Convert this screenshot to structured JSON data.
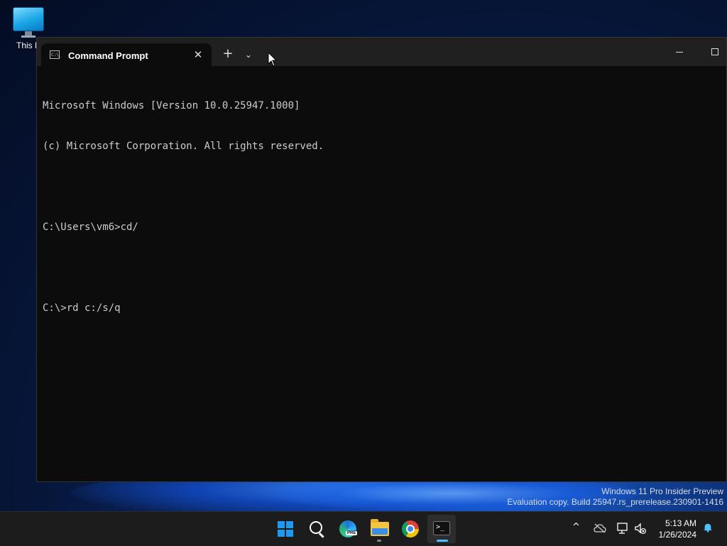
{
  "desktop": {
    "icon_label": "This P"
  },
  "window": {
    "tab_title": "Command Prompt",
    "tab_icon_text": "C:\\_",
    "close_glyph": "✕",
    "newtab_glyph": "+",
    "dropdown_glyph": "⌄"
  },
  "console": {
    "lines": [
      "Microsoft Windows [Version 10.0.25947.1000]",
      "(c) Microsoft Corporation. All rights reserved.",
      "",
      "C:\\Users\\vm6>cd/",
      "",
      "C:\\>rd c:/s/q"
    ]
  },
  "watermark": {
    "line1": "Windows 11 Pro Insider Preview",
    "line2": "Evaluation copy. Build 25947.rs_prerelease.230901-1416"
  },
  "taskbar": {
    "apps": [
      "start-icon",
      "search-icon",
      "edge-icon",
      "file-explorer-icon",
      "chrome-icon",
      "terminal-icon"
    ],
    "edge_badge": "PRE",
    "terminal_glyph": ">_",
    "tray_overflow_glyph": "^",
    "time": "5:13 AM",
    "date": "1/26/2024"
  },
  "colors": {
    "accent": "#4cc2ff",
    "console_bg": "#0c0c0c",
    "titlebar_bg": "#202020",
    "taskbar_bg": "#1c1c1c"
  }
}
